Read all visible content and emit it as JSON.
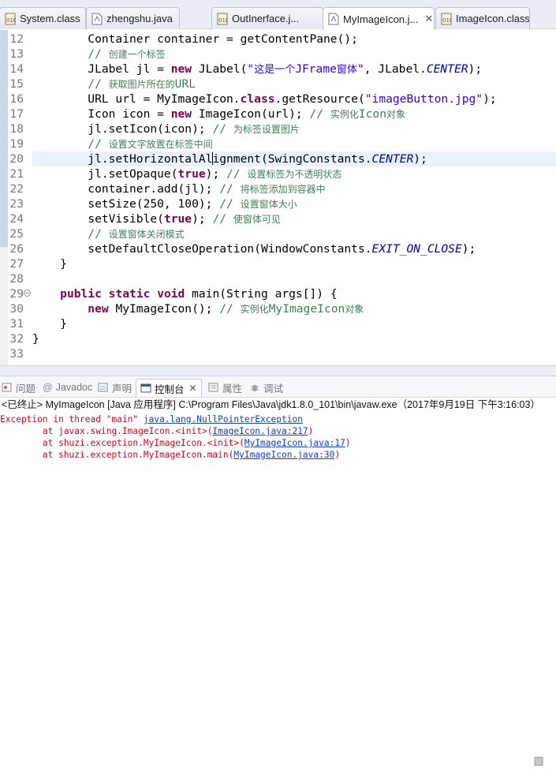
{
  "editor_tabs": [
    {
      "label": "System.class",
      "icon": "class-file-icon"
    },
    {
      "label": "zhengshu.java",
      "icon": "java-file-icon"
    },
    {
      "label": "OutInerface.j...",
      "icon": "class-file-icon"
    },
    {
      "label": "MyImageIcon.j...",
      "icon": "java-file-icon",
      "active": true,
      "close": "✕"
    },
    {
      "label": "ImageIcon.class",
      "icon": "class-file-icon"
    }
  ],
  "code_lines": [
    {
      "n": "12",
      "t": [
        [
          "p",
          "        Container container = getContentPane();"
        ]
      ]
    },
    {
      "n": "13",
      "t": [
        [
          "p",
          "        "
        ],
        [
          "c",
          "// "
        ],
        [
          "cj",
          "创建一个标签"
        ]
      ]
    },
    {
      "n": "14",
      "t": [
        [
          "p",
          "        JLabel jl = "
        ],
        [
          "k",
          "new"
        ],
        [
          "p",
          " JLabel("
        ],
        [
          "s",
          "\""
        ],
        [
          "sj",
          "这是一个"
        ],
        [
          "s",
          "JFrame"
        ],
        [
          "sj",
          "窗体"
        ],
        [
          "s",
          "\""
        ],
        [
          "p",
          ", JLabel."
        ],
        [
          "f",
          "CENTER"
        ],
        [
          "p",
          ");"
        ]
      ]
    },
    {
      "n": "15",
      "t": [
        [
          "p",
          "        "
        ],
        [
          "c",
          "// "
        ],
        [
          "cj",
          "获取图片所在的"
        ],
        [
          "c",
          "URL"
        ]
      ]
    },
    {
      "n": "16",
      "t": [
        [
          "p",
          "        URL url = MyImageIcon."
        ],
        [
          "k",
          "class"
        ],
        [
          "p",
          ".getResource("
        ],
        [
          "s",
          "\"imageButton.jpg\""
        ],
        [
          "p",
          ");"
        ]
      ]
    },
    {
      "n": "17",
      "t": [
        [
          "p",
          "        Icon icon = "
        ],
        [
          "k",
          "new"
        ],
        [
          "p",
          " ImageIcon(url); "
        ],
        [
          "c",
          "// "
        ],
        [
          "cj",
          "实例化"
        ],
        [
          "c",
          "Icon"
        ],
        [
          "cj",
          "对象"
        ]
      ]
    },
    {
      "n": "18",
      "t": [
        [
          "p",
          "        jl.setIcon(icon); "
        ],
        [
          "c",
          "// "
        ],
        [
          "cj",
          "为标签设置图片"
        ]
      ]
    },
    {
      "n": "19",
      "t": [
        [
          "p",
          "        "
        ],
        [
          "c",
          "// "
        ],
        [
          "cj",
          "设置文字放置在标签中间"
        ]
      ]
    },
    {
      "n": "20",
      "current": true,
      "t": [
        [
          "p",
          "        jl.setHorizontalAl"
        ],
        [
          "caret",
          ""
        ],
        [
          "p",
          "ignment(SwingConstants."
        ],
        [
          "f",
          "CENTER"
        ],
        [
          "p",
          ");"
        ]
      ]
    },
    {
      "n": "21",
      "t": [
        [
          "p",
          "        jl.setOpaque("
        ],
        [
          "k",
          "true"
        ],
        [
          "p",
          "); "
        ],
        [
          "c",
          "// "
        ],
        [
          "cj",
          "设置标签为不透明状态"
        ]
      ]
    },
    {
      "n": "22",
      "t": [
        [
          "p",
          "        container.add(jl); "
        ],
        [
          "c",
          "// "
        ],
        [
          "cj",
          "将标签添加到容器中"
        ]
      ]
    },
    {
      "n": "23",
      "t": [
        [
          "p",
          "        setSize(250, 100); "
        ],
        [
          "c",
          "// "
        ],
        [
          "cj",
          "设置窗体大小"
        ]
      ]
    },
    {
      "n": "24",
      "t": [
        [
          "p",
          "        setVisible("
        ],
        [
          "k",
          "true"
        ],
        [
          "p",
          "); "
        ],
        [
          "c",
          "// "
        ],
        [
          "cj",
          "使窗体可见"
        ]
      ]
    },
    {
      "n": "25",
      "t": [
        [
          "p",
          "        "
        ],
        [
          "c",
          "// "
        ],
        [
          "cj",
          "设置窗体关闭模式"
        ]
      ]
    },
    {
      "n": "26",
      "t": [
        [
          "p",
          "        setDefaultCloseOperation(WindowConstants."
        ],
        [
          "f",
          "EXIT_ON_CLOSE"
        ],
        [
          "p",
          ");"
        ]
      ]
    },
    {
      "n": "27",
      "t": [
        [
          "p",
          "    }"
        ]
      ]
    },
    {
      "n": "28",
      "t": [
        [
          "p",
          ""
        ]
      ]
    },
    {
      "n": "29",
      "fold": "−",
      "t": [
        [
          "p",
          "    "
        ],
        [
          "k",
          "public"
        ],
        [
          "p",
          " "
        ],
        [
          "k",
          "static"
        ],
        [
          "p",
          " "
        ],
        [
          "k",
          "void"
        ],
        [
          "p",
          " main(String args[]) {"
        ]
      ]
    },
    {
      "n": "30",
      "t": [
        [
          "p",
          "        "
        ],
        [
          "k",
          "new"
        ],
        [
          "p",
          " MyImageIcon(); "
        ],
        [
          "c",
          "// "
        ],
        [
          "cj",
          "实例化"
        ],
        [
          "c",
          "MyImageIcon"
        ],
        [
          "cj",
          "对象"
        ]
      ]
    },
    {
      "n": "31",
      "t": [
        [
          "p",
          "    }"
        ]
      ]
    },
    {
      "n": "32",
      "t": [
        [
          "p",
          "}"
        ]
      ]
    },
    {
      "n": "33",
      "t": [
        [
          "p",
          ""
        ]
      ]
    }
  ],
  "panel_tabs": [
    {
      "label": "问题",
      "icon": "problems-icon"
    },
    {
      "label": "Javadoc",
      "icon": "javadoc-icon",
      "prefix": "@"
    },
    {
      "label": "声明",
      "icon": "declaration-icon"
    },
    {
      "label": "控制台",
      "icon": "console-icon",
      "active": true,
      "close": "✕"
    },
    {
      "label": "属性",
      "icon": "properties-icon"
    },
    {
      "label": "调试",
      "icon": "debug-icon"
    }
  ],
  "console": {
    "header": "<已终止> MyImageIcon [Java 应用程序] C:\\Program Files\\Java\\jdk1.8.0_101\\bin\\javaw.exe（2017年9月19日 下午3:16:03）",
    "lines": [
      [
        [
          "e",
          "Exception in thread \"main\" "
        ],
        [
          "l",
          "java.lang.NullPointerException"
        ]
      ],
      [
        [
          "e",
          "\tat javax.swing.ImageIcon.<init>("
        ],
        [
          "l",
          "ImageIcon.java:217"
        ],
        [
          "e",
          ")"
        ]
      ],
      [
        [
          "e",
          "\tat shuzi.exception.MyImageIcon.<init>("
        ],
        [
          "l",
          "MyImageIcon.java:17"
        ],
        [
          "e",
          ")"
        ]
      ],
      [
        [
          "e",
          "\tat shuzi.exception.MyImageIcon.main("
        ],
        [
          "l",
          "MyImageIcon.java:30"
        ],
        [
          "e",
          ")"
        ]
      ]
    ]
  },
  "colors": {
    "keyword": "#7f0055",
    "string": "#2a00ff",
    "comment": "#3f7f5f",
    "field": "#0000c0",
    "error": "#e0001a",
    "link": "#0b3fd8"
  }
}
